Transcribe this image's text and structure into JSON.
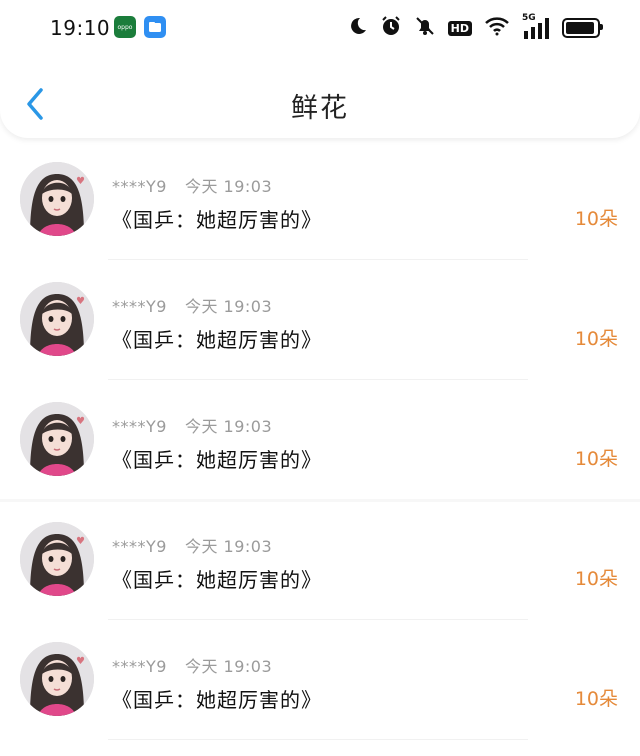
{
  "status_bar": {
    "time": "19:10",
    "apps": [
      {
        "name": "oppo",
        "label": "oppo",
        "color": "#1b7d3b"
      },
      {
        "name": "files",
        "label": "",
        "color": "#2f8ff2"
      }
    ],
    "icons": [
      "moon-icon",
      "alarm-icon",
      "bell-off-icon",
      "hd-icon",
      "wifi-icon",
      "signal-5g-icon",
      "battery-icon"
    ],
    "hd_label": "HD",
    "network_label": "5G"
  },
  "navbar": {
    "back_icon": "chevron-left-icon",
    "title": "鲜花",
    "accent": "#2a97e6"
  },
  "items": [
    {
      "user": "****Y9",
      "date": "今天 19:03",
      "message": "《国乒：她超厉害的》",
      "count": "10朵"
    },
    {
      "user": "****Y9",
      "date": "今天 19:03",
      "message": "《国乒：她超厉害的》",
      "count": "10朵"
    },
    {
      "user": "****Y9",
      "date": "今天 19:03",
      "message": "《国乒：她超厉害的》",
      "count": "10朵"
    },
    {
      "user": "****Y9",
      "date": "今天 19:03",
      "message": "《国乒：她超厉害的》",
      "count": "10朵"
    },
    {
      "user": "****Y9",
      "date": "今天 19:03",
      "message": "《国乒：她超厉害的》",
      "count": "10朵"
    }
  ],
  "colors": {
    "count": "#e58a3a",
    "meta": "#9b9b9b"
  }
}
